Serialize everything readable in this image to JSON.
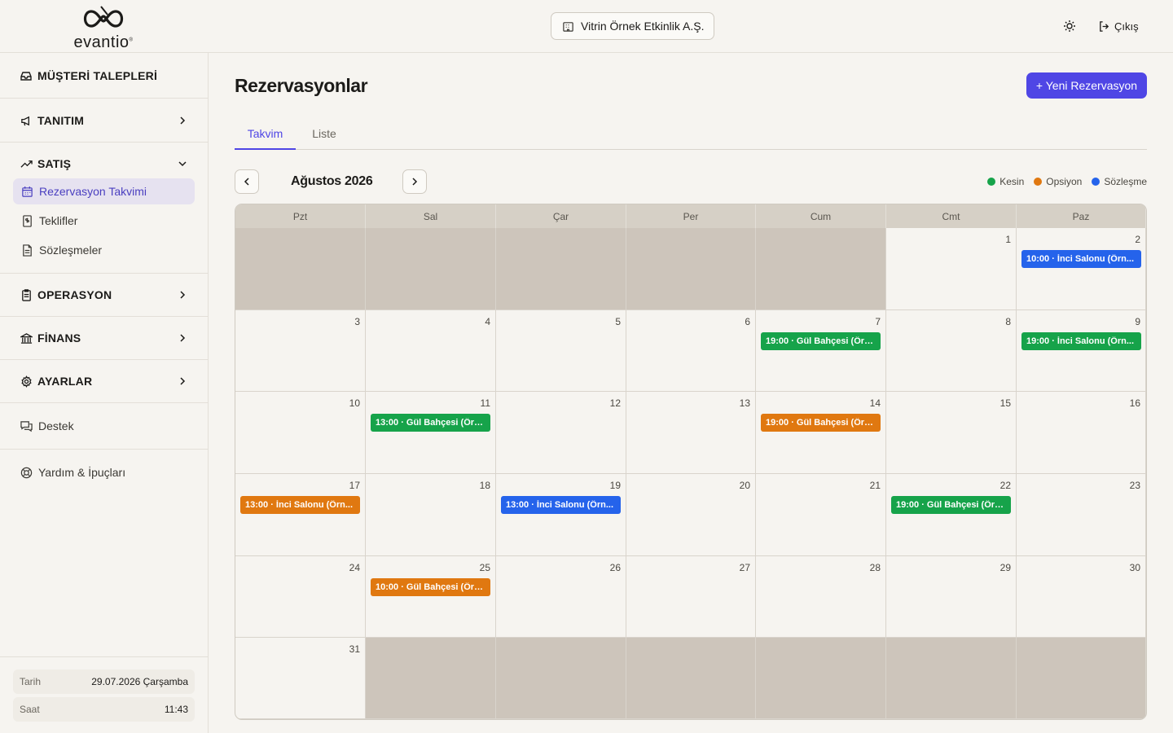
{
  "header": {
    "logo_text": "evantio",
    "company": "Vitrin Örnek Etkinlik A.Ş.",
    "logout_label": "Çıkış",
    "icons": [
      "logo-icon",
      "building-icon",
      "sun-icon",
      "logout-icon"
    ]
  },
  "sidebar": {
    "sections": {
      "requests": "MÜŞTERİ TALEPLERİ",
      "promo": "TANITIM",
      "sales": "SATIŞ",
      "ops": "OPERASYON",
      "finance": "FİNANS",
      "settings": "AYARLAR"
    },
    "sales_items": [
      "Rezervasyon Takvimi",
      "Teklifler",
      "Sözleşmeler"
    ],
    "support": "Destek",
    "help": "Yardım & İpuçları",
    "date_label": "Tarih",
    "date_value": "29.07.2026 Çarşamba",
    "time_label": "Saat",
    "time_value": "11:43"
  },
  "main": {
    "title": "Rezervasyonlar",
    "new_button": "+ Yeni Rezervasyon",
    "tabs": [
      "Takvim",
      "Liste"
    ],
    "active_tab": "Takvim",
    "month": "Ağustos 2026",
    "legend": [
      {
        "label": "Kesin",
        "color": "#16a34a"
      },
      {
        "label": "Opsiyon",
        "color": "#e07810"
      },
      {
        "label": "Sözleşme",
        "color": "#2563eb"
      }
    ],
    "weekdays": [
      "Pzt",
      "Sal",
      "Çar",
      "Per",
      "Cum",
      "Cmt",
      "Paz"
    ]
  },
  "calendar": {
    "colors": {
      "kesin": "#16a34a",
      "opsiyon": "#e07810",
      "sozlesme": "#2563eb"
    },
    "leading_blank_days": 5,
    "days_in_month": 31,
    "events": [
      {
        "day": 2,
        "text": "10:00 · İnci Salonu (Örn...",
        "status": "sozlesme"
      },
      {
        "day": 7,
        "text": "19:00 · Gül Bahçesi (Örn...",
        "status": "kesin"
      },
      {
        "day": 9,
        "text": "19:00 · İnci Salonu (Örn...",
        "status": "kesin"
      },
      {
        "day": 11,
        "text": "13:00 · Gül Bahçesi (Örn...",
        "status": "kesin"
      },
      {
        "day": 14,
        "text": "19:00 · Gül Bahçesi (Örn...",
        "status": "opsiyon"
      },
      {
        "day": 17,
        "text": "13:00 · İnci Salonu (Örn...",
        "status": "opsiyon"
      },
      {
        "day": 19,
        "text": "13:00 · İnci Salonu (Örn...",
        "status": "sozlesme"
      },
      {
        "day": 22,
        "text": "19:00 · Gül Bahçesi (Örn...",
        "status": "kesin"
      },
      {
        "day": 25,
        "text": "10:00 · Gül Bahçesi (Örn...",
        "status": "opsiyon"
      }
    ]
  }
}
